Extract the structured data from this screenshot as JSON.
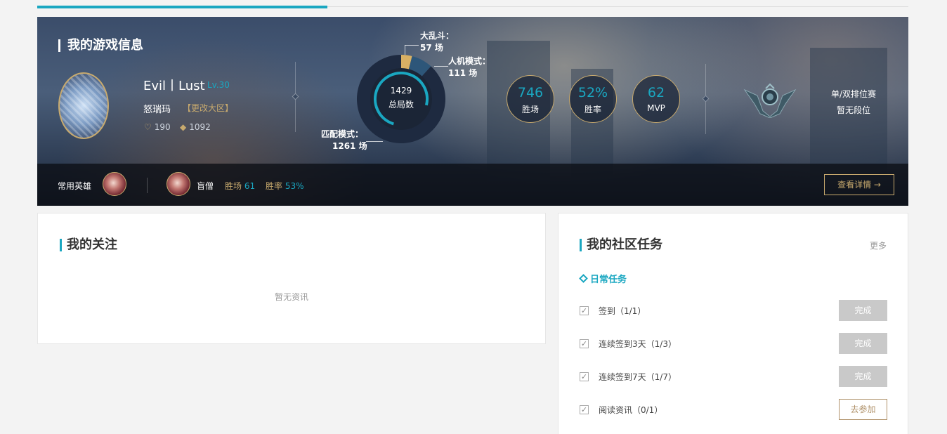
{
  "hero": {
    "title": "我的游戏信息",
    "player": {
      "name": "Evil丨Lust",
      "level": "Lv.30",
      "server": "怒瑞玛",
      "change_server": "【更改大区】",
      "hearts": "190",
      "coins": "1092"
    },
    "match_chart": {
      "total": "1429",
      "total_label": "总局数",
      "modes": [
        {
          "label": "大乱斗：",
          "count": "57 场"
        },
        {
          "label": "人机模式：",
          "count": "111 场"
        },
        {
          "label": "匹配模式：",
          "count": "1261 场"
        }
      ]
    },
    "stats": [
      {
        "value": "746",
        "label": "胜场"
      },
      {
        "value": "52%",
        "label": "胜率"
      },
      {
        "value": "62",
        "label": "MVP"
      }
    ],
    "rank": {
      "queue": "单/双排位赛",
      "status": "暂无段位"
    },
    "favorite": {
      "label": "常用英雄",
      "champion": "盲僧",
      "wins_label": "胜场",
      "wins": "61",
      "rate_label": "胜率",
      "rate": "53%"
    },
    "detail_button": "查看详情 →"
  },
  "chart_data": {
    "type": "pie",
    "categories": [
      "大乱斗",
      "人机模式",
      "匹配模式"
    ],
    "values": [
      57,
      111,
      1261
    ],
    "total": 1429,
    "colors": [
      "#d8b064",
      "#2d5679",
      "#1e2a40"
    ]
  },
  "following": {
    "title": "我的关注",
    "empty": "暂无资讯"
  },
  "tasks": {
    "title": "我的社区任务",
    "more": "更多",
    "daily_title": "日常任务",
    "items": [
      {
        "name": "签到（1/1）",
        "button": "完成"
      },
      {
        "name": "连续签到3天（1/3）",
        "button": "完成"
      },
      {
        "name": "连续签到7天（1/7）",
        "button": "完成"
      },
      {
        "name": "阅读资讯（0/1）",
        "button": "去参加"
      }
    ]
  },
  "colors": {
    "accent": "#1aa7c1",
    "gold": "#c8aa6e"
  }
}
